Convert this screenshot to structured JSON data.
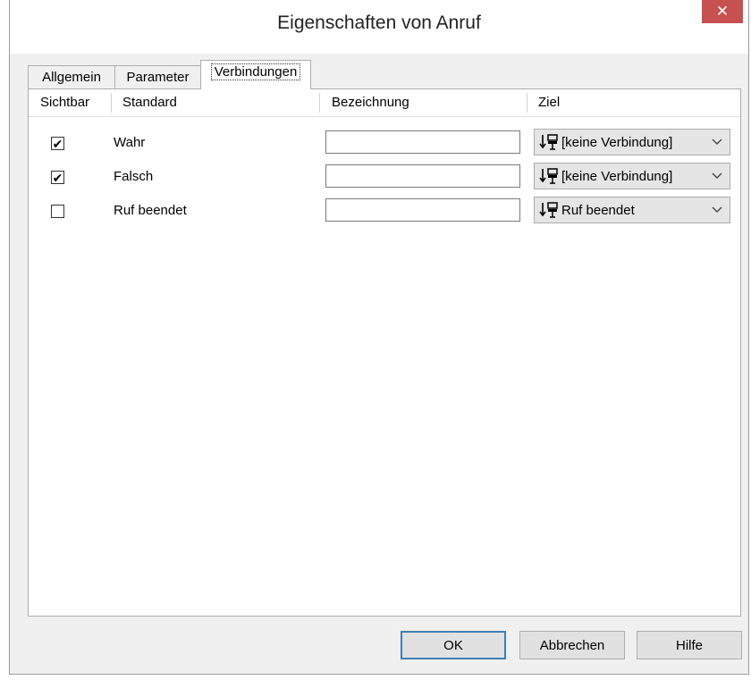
{
  "window": {
    "title": "Eigenschaften von Anruf",
    "close_glyph": "✕"
  },
  "tabs": [
    {
      "label": "Allgemein",
      "active": false
    },
    {
      "label": "Parameter",
      "active": false
    },
    {
      "label": "Verbindungen",
      "active": true
    }
  ],
  "table": {
    "headers": [
      "Sichtbar",
      "Standard",
      "Bezeichnung",
      "Ziel"
    ],
    "rows": [
      {
        "visible": true,
        "check": "✔",
        "label": "Wahr",
        "name_value": "",
        "target": "[keine Verbindung]",
        "target_icon": "connection-icon"
      },
      {
        "visible": true,
        "check": "✔",
        "label": "Falsch",
        "name_value": "",
        "target": "[keine Verbindung]",
        "target_icon": "connection-icon"
      },
      {
        "visible": false,
        "check": "",
        "label": "Ruf beendet",
        "name_value": "",
        "target": "Ruf beendet",
        "target_icon": "connection-icon"
      }
    ]
  },
  "buttons": {
    "ok": "OK",
    "cancel": "Abbrechen",
    "help": "Hilfe"
  },
  "colors": {
    "close_button": "#c75050",
    "window_bg": "#f0f0f0",
    "default_button_border": "#3c7fb1"
  }
}
